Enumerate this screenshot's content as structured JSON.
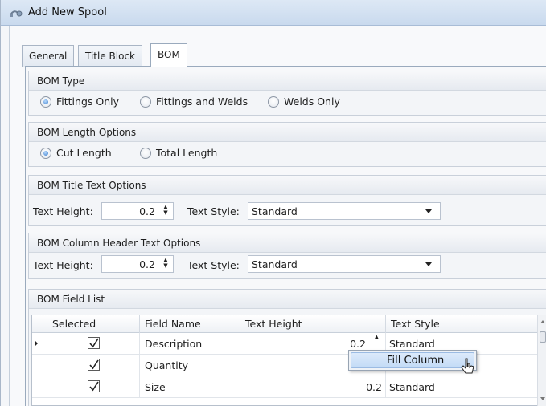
{
  "window": {
    "title": "Add New Spool"
  },
  "tabs": [
    {
      "label": "General",
      "active": false
    },
    {
      "label": "Title Block",
      "active": false
    },
    {
      "label": "BOM",
      "active": true
    }
  ],
  "bom_type": {
    "title": "BOM Type",
    "options": [
      {
        "label": "Fittings Only",
        "checked": true
      },
      {
        "label": "Fittings and Welds",
        "checked": false
      },
      {
        "label": "Welds Only",
        "checked": false
      }
    ]
  },
  "bom_length": {
    "title": "BOM Length Options",
    "options": [
      {
        "label": "Cut Length",
        "checked": true
      },
      {
        "label": "Total Length",
        "checked": false
      }
    ]
  },
  "title_text": {
    "title": "BOM Title Text Options",
    "height_label": "Text Height:",
    "height_value": "0.2",
    "style_label": "Text Style:",
    "style_value": "Standard"
  },
  "header_text": {
    "title": "BOM Column Header Text Options",
    "height_label": "Text Height:",
    "height_value": "0.2",
    "style_label": "Text Style:",
    "style_value": "Standard"
  },
  "field_list": {
    "title": "BOM Field List",
    "columns": [
      "Selected",
      "Field Name",
      "Text Height",
      "Text Style"
    ],
    "rows": [
      {
        "selected": true,
        "field": "Description",
        "height": "0.2",
        "style": "Standard"
      },
      {
        "selected": true,
        "field": "Quantity",
        "height": "",
        "style": ""
      },
      {
        "selected": true,
        "field": "Size",
        "height": "0.2",
        "style": "Standard"
      }
    ]
  },
  "context_menu": {
    "item": "Fill Column"
  },
  "icons": {
    "app": "spool-icon",
    "spin_up": "▲",
    "spin_down": "▼"
  }
}
